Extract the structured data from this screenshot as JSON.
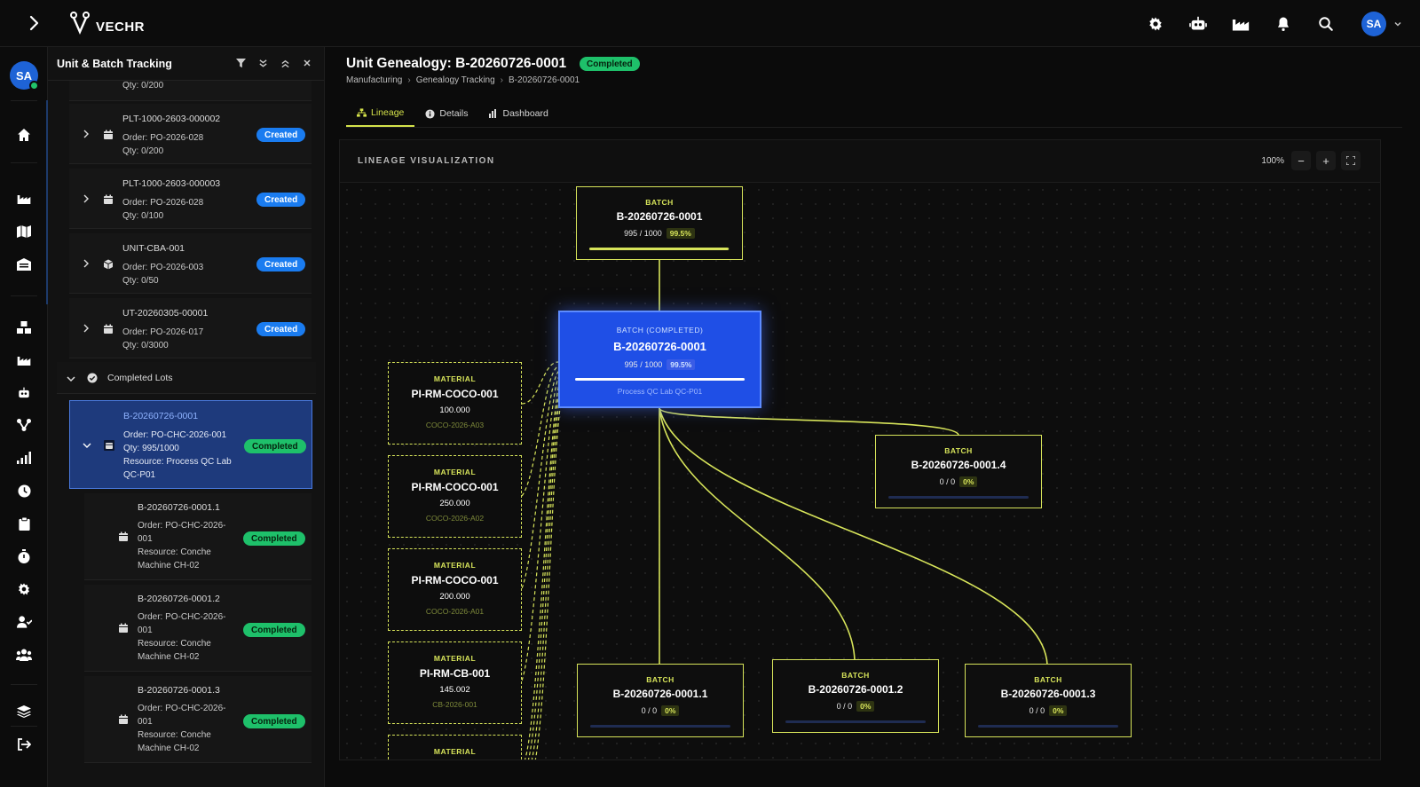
{
  "app": {
    "logo": "VECHR",
    "user_initials": "SA"
  },
  "panel": {
    "title": "Unit & Batch Tracking",
    "top_partial": {
      "qty": "Qty: 0/200"
    },
    "items": [
      {
        "name": "PLT-1000-2603-000002",
        "order": "Order: PO-2026-028",
        "qty": "Qty: 0/200",
        "status": "Created"
      },
      {
        "name": "PLT-1000-2603-000003",
        "order": "Order: PO-2026-028",
        "qty": "Qty: 0/100",
        "status": "Created"
      },
      {
        "name": "UNIT-CBA-001",
        "order": "Order: PO-2026-003",
        "qty": "Qty: 0/50",
        "status": "Created"
      },
      {
        "name": "UT-20260305-00001",
        "order": "Order: PO-2026-017",
        "qty": "Qty: 0/3000",
        "status": "Created"
      }
    ],
    "group_label": "Completed Lots",
    "selected": {
      "name": "B-20260726-0001",
      "order": "Order: PO-CHC-2026-001",
      "qty": "Qty: 995/1000",
      "resource_1": "Resource: Process QC Lab",
      "resource_2": "QC-P01",
      "status": "Completed"
    },
    "children": [
      {
        "name": "B-20260726-0001.1",
        "order_1": "Order: PO-CHC-2026-",
        "order_2": "001",
        "res_1": "Resource: Conche",
        "res_2": "Machine CH-02",
        "status": "Completed"
      },
      {
        "name": "B-20260726-0001.2",
        "order_1": "Order: PO-CHC-2026-",
        "order_2": "001",
        "res_1": "Resource: Conche",
        "res_2": "Machine CH-02",
        "status": "Completed"
      },
      {
        "name": "B-20260726-0001.3",
        "order_1": "Order: PO-CHC-2026-",
        "order_2": "001",
        "res_1": "Resource: Conche",
        "res_2": "Machine CH-02",
        "status": "Completed"
      }
    ]
  },
  "page": {
    "title": "Unit Genealogy: B-20260726-0001",
    "status": "Completed",
    "breadcrumb": [
      "Manufacturing",
      "Genealogy Tracking",
      "B-20260726-0001"
    ],
    "tabs": [
      "Lineage",
      "Details",
      "Dashboard"
    ]
  },
  "canvas": {
    "title": "LINEAGE VISUALIZATION",
    "zoom": "100%",
    "zoom_out": "−",
    "zoom_in": "+",
    "top_batch": {
      "type": "BATCH",
      "name": "B-20260726-0001",
      "count": "995 / 1000",
      "pct": "99.5%",
      "progress": 0.995
    },
    "center_batch": {
      "type": "BATCH (COMPLETED)",
      "name": "B-20260726-0001",
      "count": "995 / 1000",
      "pct": "99.5%",
      "progress": 0.995,
      "resource": "Process QC Lab QC-P01"
    },
    "materials": [
      {
        "type": "MATERIAL",
        "name": "PI-RM-COCO-001",
        "qty": "100.000",
        "lot": "COCO-2026-A03"
      },
      {
        "type": "MATERIAL",
        "name": "PI-RM-COCO-001",
        "qty": "250.000",
        "lot": "COCO-2026-A02"
      },
      {
        "type": "MATERIAL",
        "name": "PI-RM-COCO-001",
        "qty": "200.000",
        "lot": "COCO-2026-A01"
      },
      {
        "type": "MATERIAL",
        "name": "PI-RM-CB-001",
        "qty": "145.002",
        "lot": "CB-2026-001"
      },
      {
        "type": "MATERIAL"
      }
    ],
    "children": [
      {
        "type": "BATCH",
        "name": "B-20260726-0001.4",
        "count": "0 / 0",
        "pct": "0%",
        "progress": 0
      },
      {
        "type": "BATCH",
        "name": "B-20260726-0001.1",
        "count": "0 / 0",
        "pct": "0%",
        "progress": 0
      },
      {
        "type": "BATCH",
        "name": "B-20260726-0001.2",
        "count": "0 / 0",
        "pct": "0%",
        "progress": 0
      },
      {
        "type": "BATCH",
        "name": "B-20260726-0001.3",
        "count": "0 / 0",
        "pct": "0%",
        "progress": 0
      }
    ]
  },
  "colors": {
    "accent": "#d7e45a",
    "created": "#1a7cf0",
    "completed": "#1ec06a",
    "center": "#1f4fe6"
  }
}
